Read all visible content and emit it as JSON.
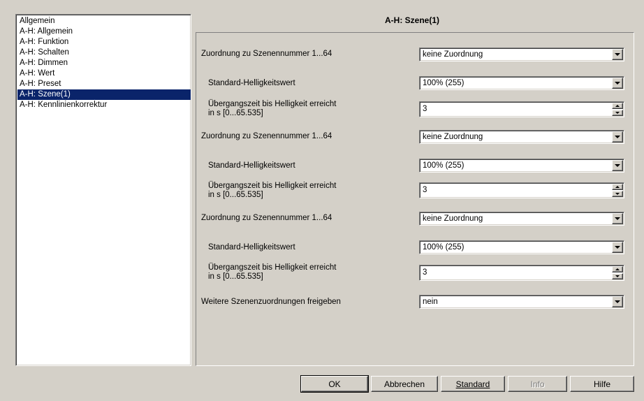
{
  "tree": {
    "items": [
      {
        "label": "Allgemein",
        "selected": false
      },
      {
        "label": "A-H: Allgemein",
        "selected": false
      },
      {
        "label": "A-H: Funktion",
        "selected": false
      },
      {
        "label": "A-H: Schalten",
        "selected": false
      },
      {
        "label": "A-H: Dimmen",
        "selected": false
      },
      {
        "label": "A-H: Wert",
        "selected": false
      },
      {
        "label": "A-H: Preset",
        "selected": false
      },
      {
        "label": "A-H: Szene(1)",
        "selected": true
      },
      {
        "label": "A-H: Kennlinienkorrektur",
        "selected": false
      }
    ]
  },
  "panel": {
    "title": "A-H: Szene(1)",
    "params": [
      {
        "label": "Zuordnung zu Szenennummer 1...64",
        "value": "keine Zuordnung",
        "type": "select"
      },
      {
        "label": "Standard-Helligkeitswert",
        "value": "100% (255)",
        "type": "select"
      },
      {
        "label_line1": "Übergangszeit bis Helligkeit erreicht",
        "label_line2": "in s [0...65.535]",
        "value": "3",
        "type": "spin"
      },
      {
        "label": "Zuordnung zu Szenennummer 1...64",
        "value": "keine Zuordnung",
        "type": "select"
      },
      {
        "label": "Standard-Helligkeitswert",
        "value": "100% (255)",
        "type": "select"
      },
      {
        "label_line1": "Übergangszeit bis Helligkeit erreicht",
        "label_line2": "in s [0...65.535]",
        "value": "3",
        "type": "spin"
      },
      {
        "label": "Zuordnung zu Szenennummer 1...64",
        "value": "keine Zuordnung",
        "type": "select"
      },
      {
        "label": "Standard-Helligkeitswert",
        "value": "100% (255)",
        "type": "select"
      },
      {
        "label_line1": "Übergangszeit bis Helligkeit erreicht",
        "label_line2": "in s [0...65.535]",
        "value": "3",
        "type": "spin"
      },
      {
        "label": "Weitere Szenenzuordnungen freigeben",
        "value": "nein",
        "type": "select"
      }
    ]
  },
  "buttons": {
    "ok": "OK",
    "cancel": "Abbrechen",
    "standard": "Standard",
    "info": "Info",
    "help": "Hilfe"
  },
  "colors": {
    "selection": "#0a246a",
    "dialog": "#d4d0c8"
  }
}
